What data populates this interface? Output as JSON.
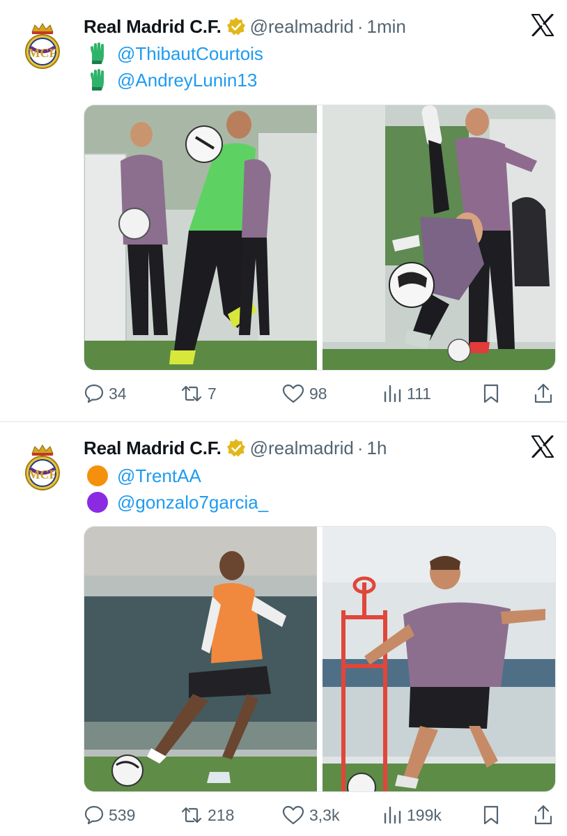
{
  "tweets": [
    {
      "author_name": "Real Madrid C.F.",
      "handle": "@realmadrid",
      "separator": "·",
      "time": "1min",
      "lines": [
        {
          "emoji": "goalkeeper-glove",
          "mention": "@ThibautCourtois"
        },
        {
          "emoji": "goalkeeper-glove",
          "mention": "@AndreyLunin13"
        }
      ],
      "stats": {
        "replies": "34",
        "reposts": "7",
        "likes": "98",
        "views": "111"
      }
    },
    {
      "author_name": "Real Madrid C.F.",
      "handle": "@realmadrid",
      "separator": "·",
      "time": "1h",
      "lines": [
        {
          "emoji": "orange-circle",
          "mention": "@TrentAA"
        },
        {
          "emoji": "purple-circle",
          "mention": "@gonzalo7garcia_"
        }
      ],
      "stats": {
        "replies": "539",
        "reposts": "218",
        "likes": "3,3k",
        "views": "199k"
      }
    }
  ],
  "colors": {
    "accent": "#1d9bf0",
    "secondary_text": "#536471",
    "verified_gold": "#e2b719",
    "glove_green": "#2fb36a",
    "orange_circle": "#f4900c",
    "purple_circle": "#8a2be2"
  },
  "icons": {
    "reply": "reply-icon",
    "repost": "repost-icon",
    "like": "heart-icon",
    "views": "views-icon",
    "bookmark": "bookmark-icon",
    "share": "share-icon",
    "platform": "x-logo-icon",
    "verified": "verified-badge-icon"
  }
}
